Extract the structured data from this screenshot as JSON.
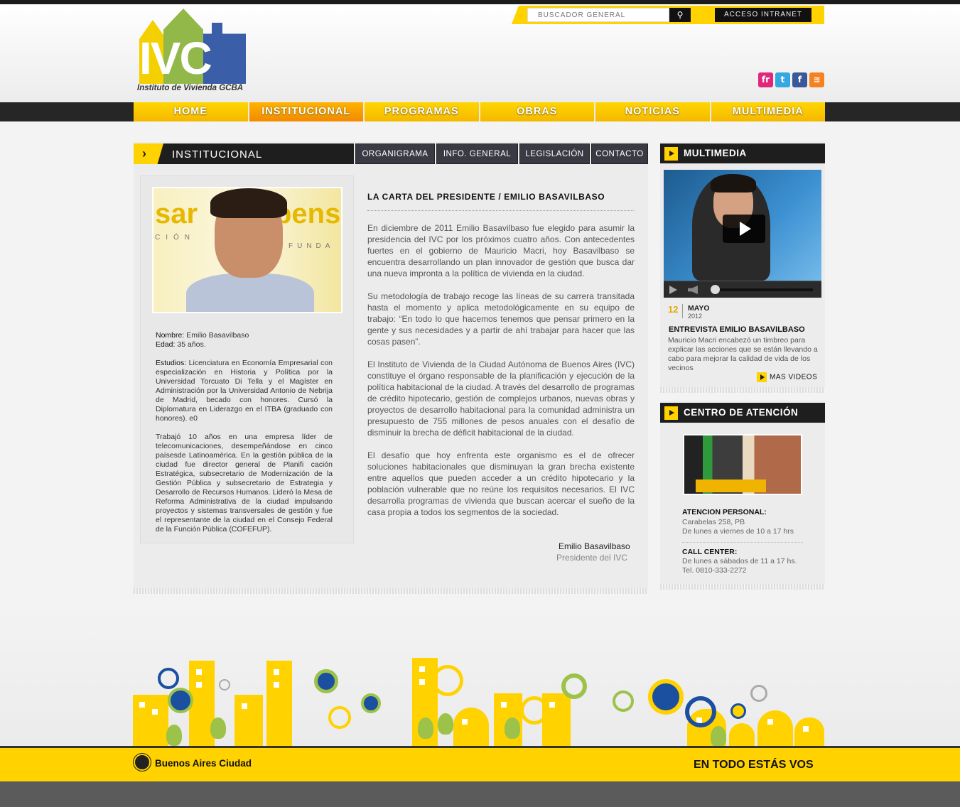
{
  "header": {
    "logo_letters": "IVC",
    "logo_subtitle": "Instituto de Vivienda GCBA",
    "search_placeholder": "BUSCADOR GENERAL",
    "intranet_label": "ACCESO INTRANET",
    "social": [
      {
        "name": "flickr",
        "glyph": "fr",
        "color": "#e0277b"
      },
      {
        "name": "twitter",
        "glyph": "t",
        "color": "#35a8e0"
      },
      {
        "name": "facebook",
        "glyph": "f",
        "color": "#3b5998"
      },
      {
        "name": "rss",
        "glyph": "≋",
        "color": "#f58220"
      }
    ]
  },
  "nav": {
    "items": [
      "HOME",
      "INSTITUCIONAL",
      "PROGRAMAS",
      "OBRAS",
      "NOTICIAS",
      "MULTIMEDIA"
    ],
    "active": "INSTITUCIONAL"
  },
  "section": {
    "title": "INSTITUCIONAL",
    "subtabs": [
      "ORGANIGRAMA",
      "INFO. GENERAL",
      "LEGISLACIÓN",
      "CONTACTO"
    ]
  },
  "bio": {
    "name_label": "Nombre:",
    "name_value": "Emilio Basavilbaso",
    "age_label": "Edad:",
    "age_value": "35 años.",
    "studies_label": "Estudios:",
    "studies_value": "Licenciatura en Economía Empresarial con especialización en Historia y Política por la Universidad Torcuato Di Tella y el Magíster en Administración por la Universidad Antonio de Nebrija de Madrid, becado con honores. Cursó la Diplomatura en Liderazgo en el ITBA (graduado con honores). e0",
    "career": "Trabajó 10 años en una empresa líder de telecomunicaciones, desempeñándose en cinco paísesde Latinoamérica. En la gestión pública de la ciudad fue director general de Planifi cación Estratégica, subsecretario de Modernización de la Gestión Pública y subsecretario de Estrategia y Desarrollo de Recursos Humanos. Lideró la Mesa de Reforma Administrativa de la ciudad impulsando proyectos y sistemas transversales de gestión y fue el representante de la ciudad en el Consejo Federal de la Función Pública (COFEFUP)."
  },
  "photo_wall_text": [
    "sar",
    "pens",
    "CIÓN",
    "FUNDA"
  ],
  "letter": {
    "title": "LA CARTA DEL PRESIDENTE / EMILIO BASAVILBASO",
    "paragraphs": [
      "En diciembre de 2011 Emilio Basavilbaso fue elegido para asumir la presidencia del IVC por los próximos cuatro años. Con antecedentes fuertes en el gobierno de Mauricio Macri, hoy Basavilbaso se encuentra desarrollando un plan innovador de gestión que busca dar una nueva impronta a la política de vivienda en la ciudad.",
      "Su metodología de trabajo recoge las líneas de su carrera transitada hasta el momento y aplica metodológicamente en su equipo de trabajo: “En todo lo que hacemos tenemos que pensar primero en la gente y sus necesidades y a partir de ahí trabajar para hacer que las cosas pasen”.",
      "El Instituto de Vivienda de la Ciudad Autónoma de Buenos Aires (IVC) constituye el órgano responsable de la planificación y ejecución de la política habitacional de la ciudad. A través del desarrollo de programas de crédito hipotecario, gestión de complejos urbanos, nuevas obras y proyectos de desarrollo habitacional para la comunidad administra un presupuesto de 755 millones de pesos anuales con el desafío de disminuir la brecha de déficit habitacional de la ciudad.",
      "El desafío que hoy enfrenta este organismo es el de ofrecer soluciones habitacionales que disminuyan la gran brecha existente entre aquellos que pueden acceder a un crédito hipotecario y la población vulnerable que no reúne los requisitos necesarios. El IVC desarrolla programas de vivienda que buscan acercar el sueño de la casa propia a todos los segmentos de la sociedad."
    ],
    "signature_name": "Emilio Basavilbaso",
    "signature_role": "Presidente del IVC"
  },
  "multimedia": {
    "title": "MULTIMEDIA",
    "date_day": "12",
    "date_month": "MAYO",
    "date_year": "2012",
    "video_title": "ENTREVISTA EMILIO BASAVILBASO",
    "video_desc": "Mauricio Macri encabezó un timbreo para explicar las acciones que se están llevando a cabo para mejorar la calidad de vida de los vecinos",
    "more_label": "MAS VIDEOS"
  },
  "attention": {
    "title": "CENTRO DE ATENCIÓN",
    "personal_label": "ATENCION PERSONAL:",
    "personal_address": "Carabelas 258, PB",
    "personal_hours": "De lunes a viernes de 10 a 17 hrs",
    "call_label": "CALL CENTER:",
    "call_hours": "De lunes a sábados de 11 a 17 hs.",
    "call_phone": "Tel. 0810-333-2272"
  },
  "footer": {
    "city_label": "Buenos Aires Ciudad",
    "slogan": "EN TODO ESTÁS VOS"
  },
  "colors": {
    "accent_yellow": "#ffd200",
    "nav_active_orange": "#f28a00",
    "dark_bar": "#1e1e1e"
  }
}
